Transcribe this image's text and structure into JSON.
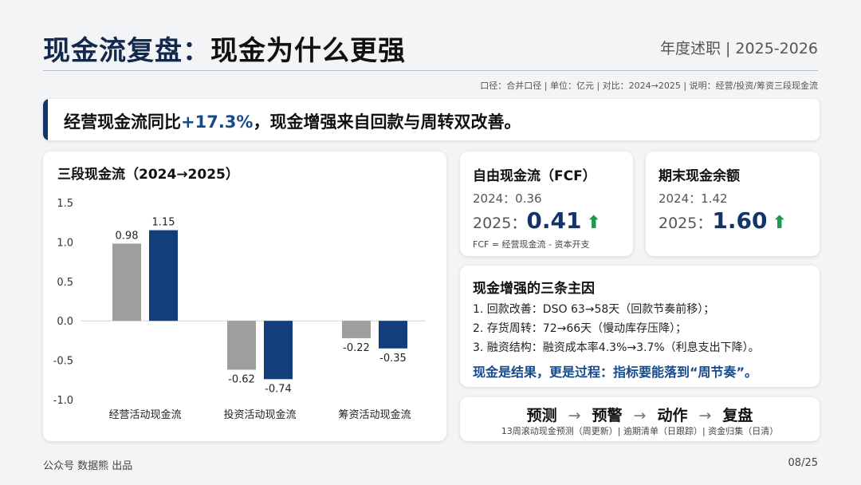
{
  "header": {
    "title_main": "现金流复盘：",
    "title_rest": "现金为什么更强",
    "top_right": "年度述职 | 2025-2026",
    "subnote": "口径：合并口径 | 单位：亿元 | 对比：2024→2025 | 说明：经营/投资/筹资三段现金流"
  },
  "banner": {
    "prefix": "经营现金流同比",
    "highlight": "+17.3%",
    "suffix": "，现金增强来自回款与周转双改善。"
  },
  "chart": {
    "title": "三段现金流（2024→2025）"
  },
  "chart_data": {
    "type": "bar",
    "categories": [
      "经营活动现金流",
      "投资活动现金流",
      "筹资活动现金流"
    ],
    "series": [
      {
        "name": "2024",
        "values": [
          0.98,
          -0.62,
          -0.22
        ],
        "color": "#9e9e9e"
      },
      {
        "name": "2025",
        "values": [
          1.15,
          -0.74,
          -0.35
        ],
        "color": "#123e7a"
      }
    ],
    "data_labels": [
      [
        "0.98",
        "-0.62",
        "-0.22"
      ],
      [
        "1.15",
        "-0.74",
        "-0.35"
      ]
    ],
    "ylim": [
      -1.0,
      1.5
    ],
    "yticks": [
      1.5,
      1.0,
      0.5,
      0.0,
      -0.5,
      -1.0
    ],
    "ytick_labels": [
      "1.5",
      "1.0",
      "0.5",
      "0.0",
      "-0.5",
      "-1.0"
    ],
    "title": "三段现金流（2024→2025）",
    "grid": false
  },
  "fcf": {
    "title": "自由现金流（FCF）",
    "prev": "2024：0.36",
    "cur_label": "2025：",
    "cur_value": "0.41",
    "arrow": "⬆",
    "note": "FCF = 经营现金流 - 资本开支"
  },
  "cash": {
    "title": "期末现金余额",
    "prev": "2024：1.42",
    "cur_label": "2025：",
    "cur_value": "1.60",
    "arrow": "⬆"
  },
  "reasons": {
    "title": "现金增强的三条主因",
    "items": [
      "1. 回款改善：DSO 63→58天（回款节奏前移）；",
      "2. 存货周转：72→66天（慢动库存压降）；",
      "3. 融资结构：融资成本率4.3%→3.7%（利息支出下降）。"
    ],
    "footer": "现金是结果，更是过程：指标要能落到“周节奏”。"
  },
  "flow": {
    "steps": [
      "预测",
      "预警",
      "动作",
      "复盘"
    ],
    "separator": "→",
    "sub": "13周滚动现金预测（周更新）| 逾期清单（日跟踪）| 资金归集（日清）"
  },
  "footer": {
    "left": "公众号 数据熊 出品",
    "right": "08/25"
  }
}
